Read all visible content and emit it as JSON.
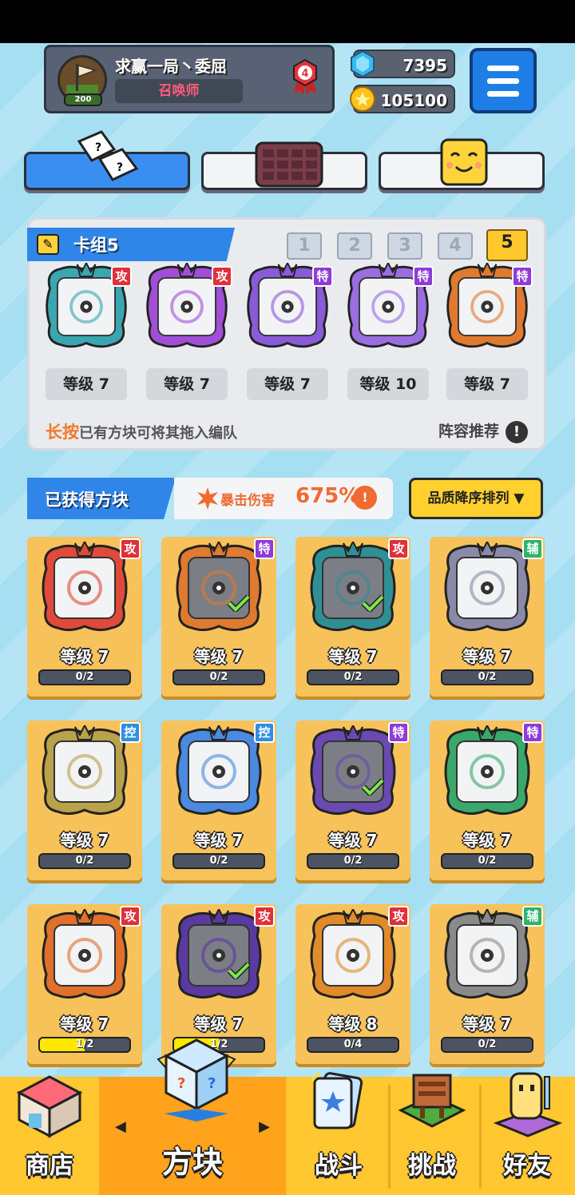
{
  "player": {
    "name": "求赢一局丶委屈",
    "title": "召唤师",
    "level": "200",
    "rank": "4"
  },
  "resources": {
    "gems": "7395",
    "coins": "105100"
  },
  "tabs": [
    {
      "id": "dice",
      "active": true
    },
    {
      "id": "board",
      "active": false
    },
    {
      "id": "emote",
      "active": false
    }
  ],
  "deck": {
    "title": "卡组5",
    "slots": [
      "1",
      "2",
      "3",
      "4",
      "5"
    ],
    "active_slot": "5",
    "cards": [
      {
        "tag": "攻",
        "level": "等级 7",
        "color": "#3aa6b0"
      },
      {
        "tag": "攻",
        "level": "等级 7",
        "color": "#a14fd8"
      },
      {
        "tag": "特",
        "level": "等级 7",
        "color": "#8a5ad8"
      },
      {
        "tag": "特",
        "level": "等级 10",
        "color": "#9a6ee0"
      },
      {
        "tag": "特",
        "level": "等级 7",
        "color": "#e07a30"
      }
    ],
    "hint_long": "长按",
    "hint_rest": "已有方块可将其拖入编队",
    "recommend": "阵容推荐",
    "recommend_icon": "!"
  },
  "owned": {
    "title": "已获得方块",
    "crit_label": "暴击伤害",
    "crit_value": "675%",
    "crit_icon": "!",
    "sort_label": "品质降序排列 ▼",
    "cards": [
      {
        "tag": "攻",
        "tag_color": "#e0313b",
        "level": "等级 7",
        "progress": "0/2",
        "fill": 0,
        "equipped": false,
        "color": "#e04a3a",
        "dark": false
      },
      {
        "tag": "特",
        "tag_color": "#8e3bd8",
        "level": "等级 7",
        "progress": "0/2",
        "fill": 0,
        "equipped": true,
        "color": "#e07a30",
        "dark": true
      },
      {
        "tag": "攻",
        "tag_color": "#e0313b",
        "level": "等级 7",
        "progress": "0/2",
        "fill": 0,
        "equipped": true,
        "color": "#2f8f94",
        "dark": true
      },
      {
        "tag": "辅",
        "tag_color": "#2fb46a",
        "level": "等级 7",
        "progress": "0/2",
        "fill": 0,
        "equipped": false,
        "color": "#8a8aa8",
        "dark": false
      },
      {
        "tag": "控",
        "tag_color": "#2f8ee0",
        "level": "等级 7",
        "progress": "0/2",
        "fill": 0,
        "equipped": false,
        "color": "#b8a24a",
        "dark": false
      },
      {
        "tag": "控",
        "tag_color": "#2f8ee0",
        "level": "等级 7",
        "progress": "0/2",
        "fill": 0,
        "equipped": false,
        "color": "#4a8ae0",
        "dark": false
      },
      {
        "tag": "特",
        "tag_color": "#8e3bd8",
        "level": "等级 7",
        "progress": "0/2",
        "fill": 0,
        "equipped": true,
        "color": "#6a4ab0",
        "dark": true
      },
      {
        "tag": "特",
        "tag_color": "#8e3bd8",
        "level": "等级 7",
        "progress": "0/2",
        "fill": 0,
        "equipped": false,
        "color": "#3aa86a",
        "dark": false
      },
      {
        "tag": "攻",
        "tag_color": "#e0313b",
        "level": "等级 7",
        "progress": "1/2",
        "fill": 0.5,
        "equipped": false,
        "color": "#e0702a",
        "dark": false
      },
      {
        "tag": "攻",
        "tag_color": "#e0313b",
        "level": "等级 7",
        "progress": "1/2",
        "fill": 0.5,
        "equipped": true,
        "color": "#5a3aa0",
        "dark": true
      },
      {
        "tag": "攻",
        "tag_color": "#e0313b",
        "level": "等级 8",
        "progress": "0/4",
        "fill": 0,
        "equipped": false,
        "color": "#e08a2a",
        "dark": false
      },
      {
        "tag": "辅",
        "tag_color": "#2fb46a",
        "level": "等级 7",
        "progress": "0/2",
        "fill": 0,
        "equipped": false,
        "color": "#8a8a8a",
        "dark": false
      }
    ]
  },
  "nav": {
    "shop": "商店",
    "blocks": "方块",
    "battle": "战斗",
    "challenge": "挑战",
    "friends": "好友",
    "prev": "◀",
    "next": "▶"
  }
}
